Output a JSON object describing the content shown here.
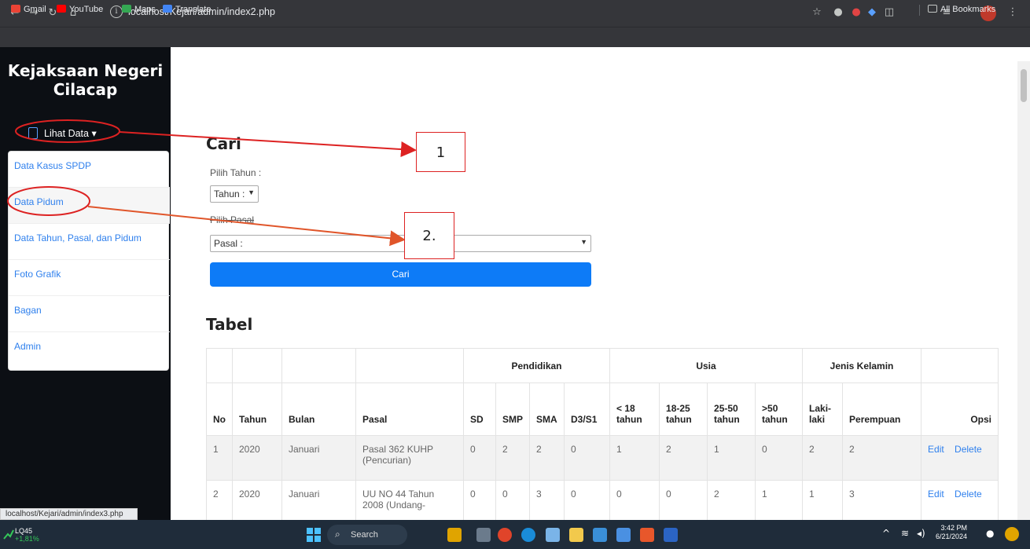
{
  "browser": {
    "url": "localhost/Kejari/admin/index2.php",
    "bookmarks": [
      "Gmail",
      "YouTube",
      "Maps",
      "Translate"
    ],
    "all_bookmarks": "All Bookmarks",
    "status_url": "localhost/Kejari/admin/index3.php"
  },
  "sidebar": {
    "brand_line1": "Kejaksaan Negeri",
    "brand_line2": "Cilacap",
    "dropdown_label": "Lihat Data ▾",
    "items": [
      {
        "label": "Data Kasus SPDP"
      },
      {
        "label": "Data Pidum"
      },
      {
        "label": "Data Tahun, Pasal, dan Pidum"
      },
      {
        "label": "Foto Grafik"
      },
      {
        "label": "Bagan"
      },
      {
        "label": "Admin"
      }
    ]
  },
  "search": {
    "heading": "Cari",
    "year_label": "Pilih Tahun :",
    "year_value": "Tahun :",
    "pasal_label": "Pilih Pasal",
    "pasal_value": "Pasal :",
    "button": "Cari"
  },
  "table": {
    "heading": "Tabel",
    "group_headers": {
      "pendidikan": "Pendidikan",
      "usia": "Usia",
      "jenis_kelamin": "Jenis Kelamin"
    },
    "columns": [
      "No",
      "Tahun",
      "Bulan",
      "Pasal",
      "SD",
      "SMP",
      "SMA",
      "D3/S1",
      "< 18 tahun",
      "18-25 tahun",
      "25-50 tahun",
      ">50 tahun",
      "Laki-laki",
      "Perempuan",
      "Opsi"
    ],
    "rows": [
      {
        "no": "1",
        "tahun": "2020",
        "bulan": "Januari",
        "pasal": "Pasal 362 KUHP (Pencurian)",
        "sd": "0",
        "smp": "2",
        "sma": "2",
        "d3s1": "0",
        "u18": "1",
        "u1825": "2",
        "u2550": "1",
        "u50": "0",
        "laki": "2",
        "perempuan": "2",
        "edit": "Edit",
        "delete": "Delete"
      },
      {
        "no": "2",
        "tahun": "2020",
        "bulan": "Januari",
        "pasal": "UU NO 44 Tahun 2008 (Undang-",
        "sd": "0",
        "smp": "0",
        "sma": "3",
        "d3s1": "0",
        "u18": "0",
        "u1825": "0",
        "u2550": "2",
        "u50": "1",
        "laki": "1",
        "perempuan": "3",
        "edit": "Edit",
        "delete": "Delete"
      }
    ]
  },
  "annotations": {
    "box1": "1",
    "box2": "2."
  },
  "taskbar": {
    "stock_name": "LQ45",
    "stock_change": "+1,81%",
    "search": "Search",
    "time": "3:42 PM",
    "date": "6/21/2024"
  }
}
